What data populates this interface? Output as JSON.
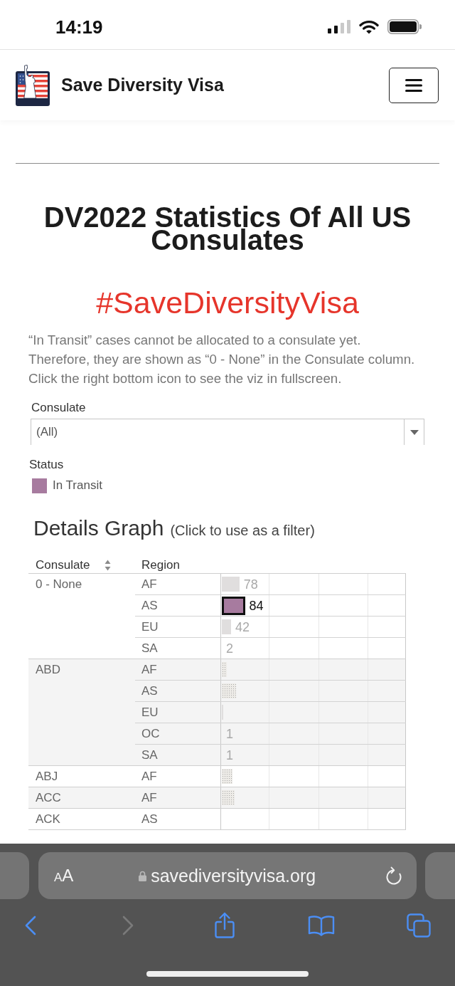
{
  "status_bar": {
    "time": "14:19"
  },
  "header": {
    "site_name": "Save Diversity Visa"
  },
  "page": {
    "title": "DV2022 Statistics Of All US Consulates",
    "hashtag": "#SaveDiversityVisa",
    "intro": "“In Transit” cases cannot be allocated to a consulate yet.\nTherefore, they are shown as “0 - None” in the Consulate column.\nClick the right bottom icon to see the viz in fullscreen."
  },
  "filters": {
    "consulate_label": "Consulate",
    "consulate_value": "(All)",
    "status_label": "Status",
    "legend": [
      {
        "label": "In Transit",
        "color": "#a77b9f"
      }
    ]
  },
  "details": {
    "title": "Details Graph",
    "hint": "(Click to use as a filter)",
    "columns": [
      {
        "label": "Consulate",
        "sorted": true
      },
      {
        "label": "Region",
        "sorted": false
      }
    ],
    "groups": [
      {
        "consulate": "0 - None",
        "rows": [
          {
            "region": "AF",
            "value": "78",
            "selected": false,
            "bar": {
              "kind": "solid",
              "level": 0.096
            }
          },
          {
            "region": "AS",
            "value": "84",
            "selected": true,
            "bar": {
              "kind": "solid",
              "level": 0.103
            }
          },
          {
            "region": "EU",
            "value": "42",
            "selected": false,
            "bar": {
              "kind": "solid",
              "level": 0.05
            }
          },
          {
            "region": "SA",
            "value": "2",
            "selected": false
          }
        ]
      },
      {
        "consulate": "ABD",
        "rows": [
          {
            "region": "AF",
            "selected": false,
            "bar": {
              "kind": "dotted",
              "level": 0.027
            }
          },
          {
            "region": "AS",
            "selected": false,
            "bar": {
              "kind": "dotted",
              "level": 0.077
            }
          },
          {
            "region": "EU",
            "selected": false,
            "bar": {
              "kind": "solid",
              "level": 0.008
            }
          },
          {
            "region": "OC",
            "value": "1",
            "selected": false
          },
          {
            "region": "SA",
            "value": "1",
            "selected": false
          }
        ]
      },
      {
        "consulate": "ABJ",
        "rows": [
          {
            "region": "AF",
            "selected": false,
            "bar": {
              "kind": "dotted",
              "level": 0.057
            }
          }
        ]
      },
      {
        "consulate": "ACC",
        "rows": [
          {
            "region": "AF",
            "selected": false,
            "bar": {
              "kind": "dotted",
              "level": 0.069
            }
          }
        ]
      },
      {
        "consulate": "ACK",
        "rows": [
          {
            "region": "AS"
          }
        ]
      }
    ]
  },
  "browser": {
    "text_size": {
      "small": "A",
      "large": "A"
    },
    "url": "savediversityvisa.org",
    "toolbar": [
      {
        "kind": "back",
        "disabled": false
      },
      {
        "kind": "forward",
        "disabled": true
      },
      {
        "kind": "share",
        "disabled": false
      },
      {
        "kind": "bookmarks",
        "disabled": false
      },
      {
        "kind": "tabs",
        "disabled": false
      }
    ]
  }
}
